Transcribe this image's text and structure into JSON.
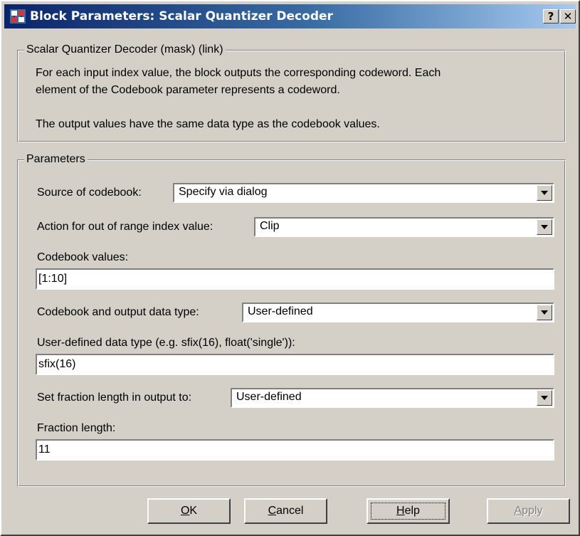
{
  "window": {
    "title": "Block Parameters: Scalar Quantizer Decoder",
    "help_glyph": "?",
    "close_glyph": "✕"
  },
  "description": {
    "legend": "Scalar Quantizer Decoder (mask) (link)",
    "line1": "For each input index value, the block outputs the corresponding codeword. Each",
    "line2": "element of the Codebook parameter represents a codeword.",
    "line3": "The output values have the same data type as the codebook values."
  },
  "parameters": {
    "legend": "Parameters",
    "source_of_codebook": {
      "label": "Source of codebook:",
      "value": "Specify via dialog"
    },
    "out_of_range_action": {
      "label": "Action for out of range index value:",
      "value": "Clip"
    },
    "codebook_values": {
      "label": "Codebook values:",
      "value": "[1:10]"
    },
    "codebook_output_type": {
      "label": "Codebook and output data type:",
      "value": "User-defined"
    },
    "user_defined_type": {
      "label": "User-defined data type (e.g. sfix(16), float('single')):",
      "value": "sfix(16)"
    },
    "fraction_length_mode": {
      "label": "Set fraction length in output to:",
      "value": "User-defined"
    },
    "fraction_length": {
      "label": "Fraction length:",
      "value": "11"
    }
  },
  "buttons": {
    "ok": {
      "mnemonic": "O",
      "rest": "K"
    },
    "cancel": {
      "mnemonic": "C",
      "rest": "ancel"
    },
    "help": {
      "mnemonic": "H",
      "rest": "elp"
    },
    "apply": {
      "mnemonic": "A",
      "rest": "pply"
    }
  },
  "colors": {
    "title_gradient_start": "#0a246a",
    "title_gradient_end": "#a6caf0",
    "dialog_face": "#d4d0c8"
  }
}
